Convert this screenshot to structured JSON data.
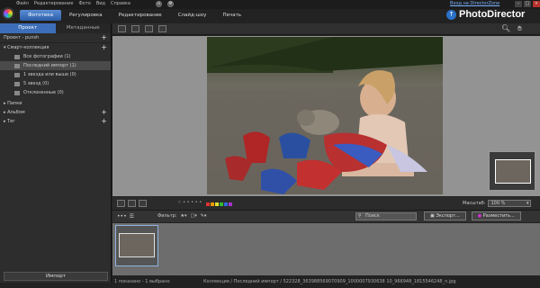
{
  "menu": [
    "Файл",
    "Редактирование",
    "Фото",
    "Вид",
    "Справка"
  ],
  "window_link": "Вход на DirectorZone",
  "mode_tabs": [
    "Фототека",
    "Регулировка",
    "Редактирование",
    "Слайд-шоу",
    "Печать"
  ],
  "brand": {
    "name": "PhotoDirector"
  },
  "panel_tabs": [
    "Проект",
    "Метаданные"
  ],
  "project_label": "Проект - punsh",
  "smart_collection": {
    "title": "Смарт-коллекция",
    "items": [
      {
        "label": "Все фотографии (1)",
        "selected": false
      },
      {
        "label": "Последний импорт (1)",
        "selected": true
      },
      {
        "label": "1 звезда или выше (0)",
        "selected": false
      },
      {
        "label": "5 звезд (0)",
        "selected": false
      },
      {
        "label": "Отклоненные (0)",
        "selected": false
      }
    ]
  },
  "sections": [
    "Папки",
    "Альбом",
    "Тег"
  ],
  "import_button": "Импорт",
  "filter_label": "Фильтр:",
  "search_placeholder": "Поиск",
  "export_button": "Экспорт...",
  "share_button": "Разместить...",
  "zoom_label": "Масштаб:",
  "zoom_value": "100 %",
  "color_labels": [
    "#d33",
    "#e90",
    "#dd3",
    "#3b3",
    "#36d",
    "#a3c"
  ],
  "status_left": "1 показано - 1 выбрано",
  "status_path": "Коллекция / Последний импорт / 522328_363988569070909_1000007930638 10_966948_1815546248_n.jpg",
  "icons": [
    "photodirector-logo-icon",
    "home-icon",
    "settings-icon",
    "search-icon",
    "hand-icon"
  ]
}
